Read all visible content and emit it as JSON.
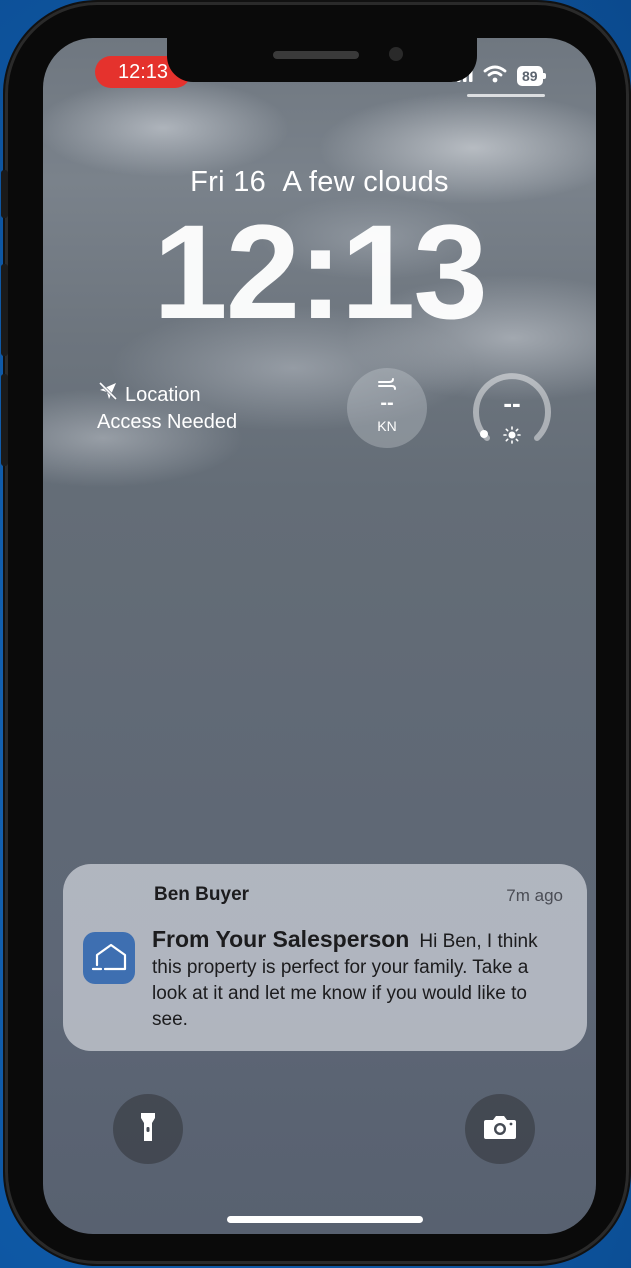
{
  "status_bar": {
    "time": "12:13",
    "battery": "89",
    "signal_icon": "signal-bars-icon",
    "wifi_icon": "wifi-icon",
    "accent_color": "#e5322d"
  },
  "lock_screen": {
    "date": "Fri 16",
    "weather": "A few clouds",
    "time": "12:13"
  },
  "widgets": {
    "location": {
      "icon": "location-off-icon",
      "line1": "Location",
      "line2": "Access Needed"
    },
    "wind": {
      "icon": "wind-arrow-icon",
      "value": "--",
      "unit": "KN"
    },
    "uv": {
      "icon": "sun-icon",
      "value": "--"
    }
  },
  "notification": {
    "sender": "Ben Buyer",
    "time_ago": "7m ago",
    "app_icon": "home-icon",
    "title": "From Your  Salesperson",
    "message": "Hi Ben,  I think this property is perfect for your family. Take a look at it and let me know if you would like to see."
  },
  "bottom_controls": {
    "left": "flashlight-icon",
    "right": "camera-icon"
  }
}
